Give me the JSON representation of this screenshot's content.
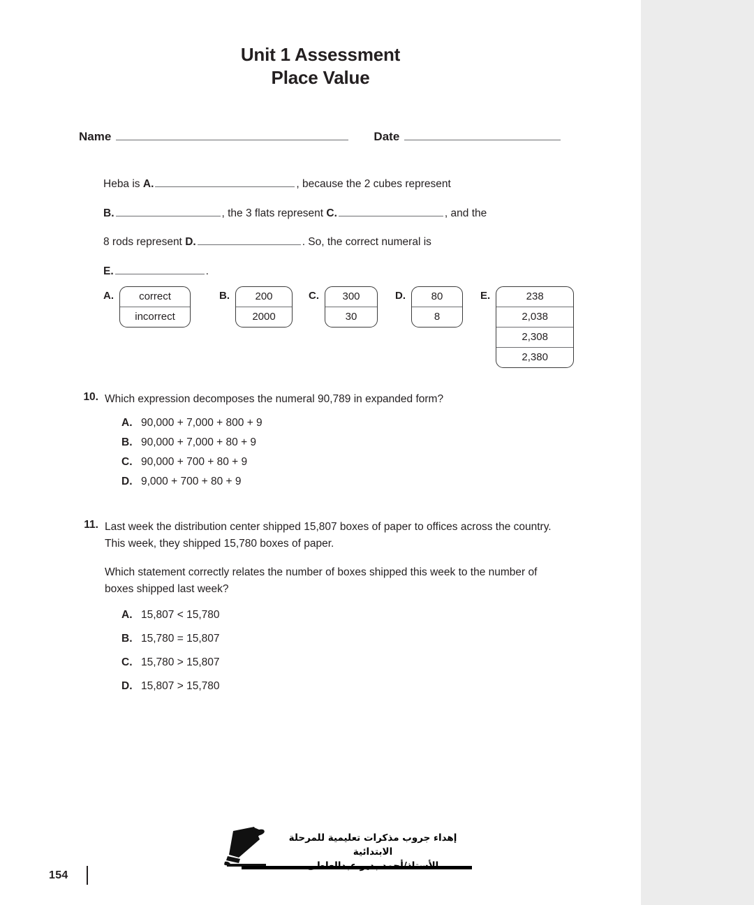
{
  "page": {
    "number": "154",
    "background_color": "#ececec",
    "paper_color": "#ffffff",
    "text_color": "#231f20"
  },
  "header": {
    "title_line1": "Unit 1 Assessment",
    "title_line2": "Place Value"
  },
  "namedate": {
    "name_label": "Name",
    "date_label": "Date"
  },
  "fill_in": {
    "line1_pre": "Heba is ",
    "line1_letter": "A.",
    "line1_post": ", because the 2 cubes represent",
    "line2_letter": "B.",
    "line2_mid": ", the 3 flats represent ",
    "line2_letter2": "C.",
    "line2_post": ", and the",
    "line3_pre": "8 rods represent ",
    "line3_letter": "D.",
    "line3_post": ". So, the correct numeral is",
    "line4_letter": "E.",
    "line4_post": "."
  },
  "choice_boxes": [
    {
      "letter": "A.",
      "cells": [
        "correct",
        "incorrect"
      ]
    },
    {
      "letter": "B.",
      "cells": [
        "200",
        "2000"
      ]
    },
    {
      "letter": "C.",
      "cells": [
        "300",
        "30"
      ]
    },
    {
      "letter": "D.",
      "cells": [
        "80",
        "8"
      ]
    },
    {
      "letter": "E.",
      "cells": [
        "238",
        "2,038",
        "2,308",
        "2,380"
      ]
    }
  ],
  "questions": [
    {
      "number": "10.",
      "stem": "Which expression decomposes the numeral 90,789 in expanded form?",
      "options": [
        {
          "letter": "A.",
          "text": "90,000 + 7,000 + 800 + 9"
        },
        {
          "letter": "B.",
          "text": "90,000 + 7,000 + 80 + 9"
        },
        {
          "letter": "C.",
          "text": "90,000 + 700 + 80 + 9"
        },
        {
          "letter": "D.",
          "text": "9,000 + 700 + 80 + 9"
        }
      ]
    },
    {
      "number": "11.",
      "stem": "Last week the distribution center shipped 15,807 boxes of paper to offices across the country. This week, they shipped 15,780 boxes of paper.",
      "sub": "Which statement correctly relates the number of boxes shipped this week to the number of boxes shipped last week?",
      "options": [
        {
          "letter": "A.",
          "text": "15,807 < 15,780"
        },
        {
          "letter": "B.",
          "text": "15,780 = 15,807"
        },
        {
          "letter": "C.",
          "text": "15,780 > 15,807"
        },
        {
          "letter": "D.",
          "text": "15,807 > 15,780"
        }
      ]
    }
  ],
  "footer_stamp": {
    "icon": "graduation-cap-icon",
    "line1": "إهداء جروب مذكرات تعليمية للمرحلة الابتدائية",
    "line2": "الأستاذ/أحمد بدير عبدالعاطى"
  }
}
